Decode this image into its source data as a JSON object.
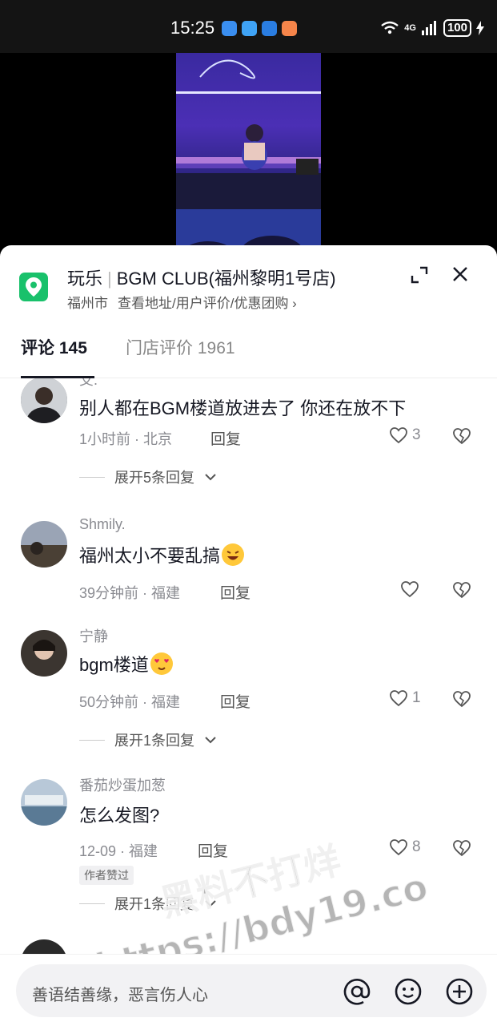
{
  "status_bar": {
    "time": "15:25",
    "network": "4G",
    "battery": "100"
  },
  "place": {
    "category": "玩乐",
    "name": "BGM CLUB(福州黎明1号店)",
    "city": "福州市",
    "links": "查看地址/用户评价/优惠团购 ›"
  },
  "tabs": [
    {
      "label": "评论 145"
    },
    {
      "label": "门店评价 1961"
    }
  ],
  "comments": [
    {
      "name": "艾.",
      "text": "别人都在BGM楼道放进去了 你还在放不下",
      "time": "1小时前 · 北京",
      "reply": "回复",
      "likes": "3",
      "expand": "展开5条回复"
    },
    {
      "name": "Shmily.",
      "text": "福州太小不要乱搞",
      "emoji": "laughing-emoji",
      "time": "39分钟前 · 福建",
      "reply": "回复",
      "likes": ""
    },
    {
      "name": "宁静",
      "text": "bgm楼道",
      "emoji": "heart-eyes-emoji",
      "time": "50分钟前 · 福建",
      "reply": "回复",
      "likes": "1",
      "expand": "展开1条回复"
    },
    {
      "name": "番茄炒蛋加葱",
      "text": "怎么发图?",
      "time": "12-09 · 福建",
      "reply": "回复",
      "likes": "8",
      "badge": "作者赞过",
      "expand": "展开1条回复"
    }
  ],
  "watermark": "黑料不打烊\nhttps://bdy19.co",
  "input": {
    "placeholder": "善语结善缘，恶言伤人心"
  },
  "colors": {
    "accent_green": "#19c16b",
    "text_primary": "#161823",
    "text_secondary": "#8a8b91"
  }
}
